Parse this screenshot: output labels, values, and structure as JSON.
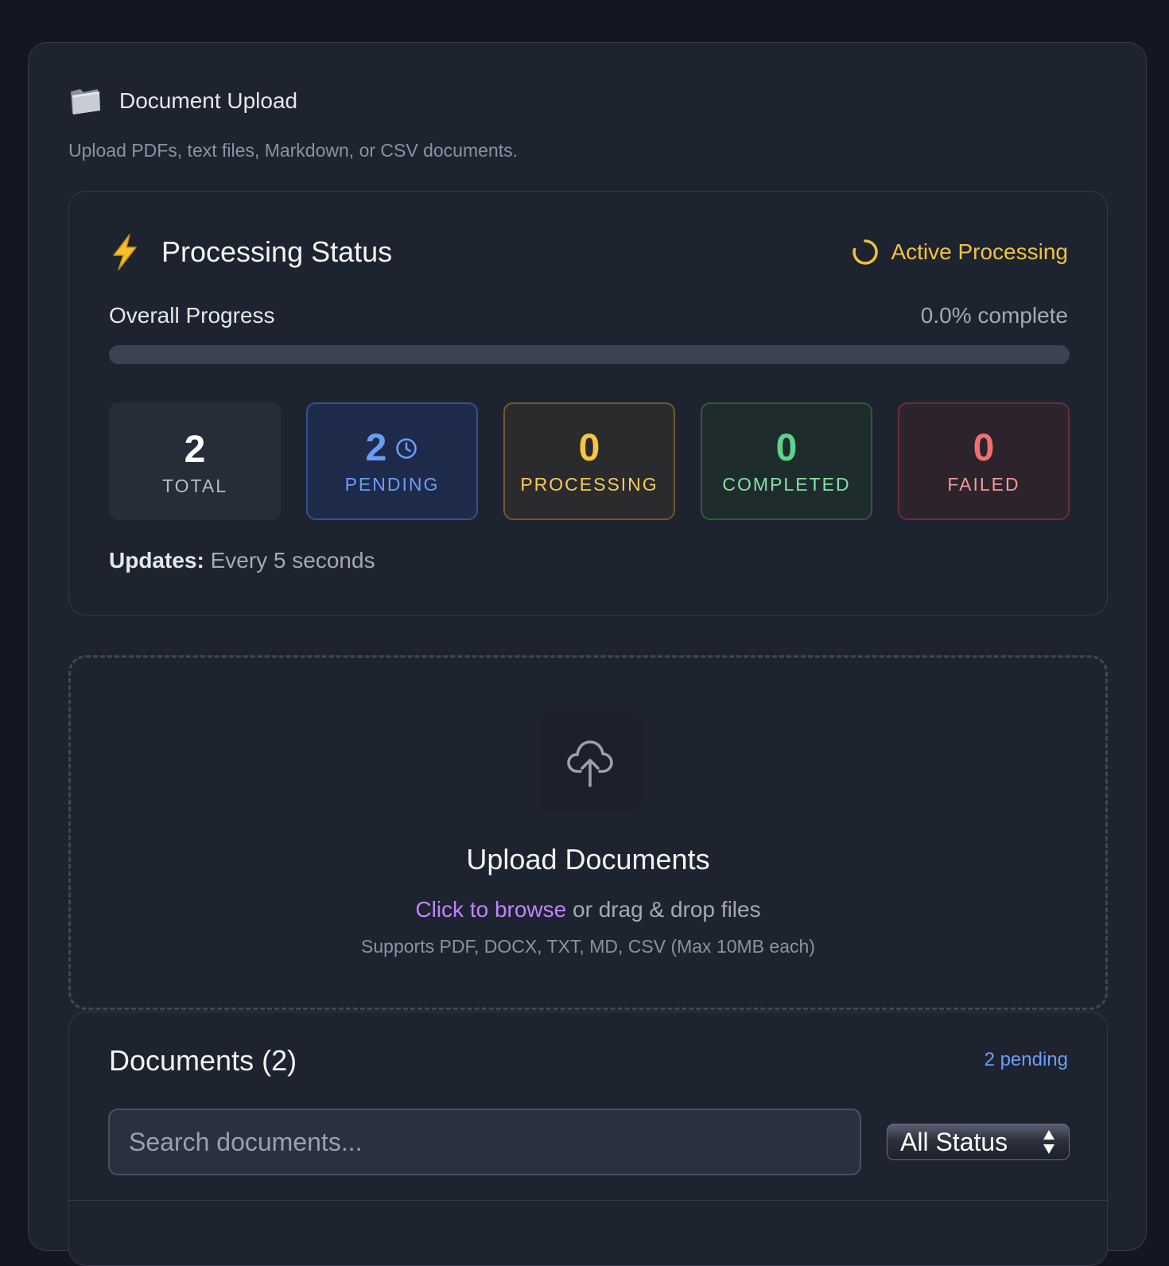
{
  "header": {
    "title": "Document Upload",
    "subtitle": "Upload PDFs, text files, Markdown, or CSV documents."
  },
  "processing": {
    "title": "Processing Status",
    "active_label": "Active Processing",
    "progress_label": "Overall Progress",
    "progress_text": "0.0% complete",
    "progress_fraction": 0.0,
    "stats": {
      "total": {
        "value": "2",
        "label": "TOTAL"
      },
      "pending": {
        "value": "2",
        "label": "PENDING"
      },
      "processing": {
        "value": "0",
        "label": "PROCESSING"
      },
      "completed": {
        "value": "0",
        "label": "COMPLETED"
      },
      "failed": {
        "value": "0",
        "label": "FAILED"
      }
    },
    "updates_label": "Updates:",
    "updates_value": "Every 5 seconds"
  },
  "upload": {
    "title": "Upload Documents",
    "browse_link": "Click to browse",
    "drag_text": "or drag & drop files",
    "supports": "Supports PDF, DOCX, TXT, MD, CSV (Max 10MB each)"
  },
  "documents": {
    "title": "Documents (2)",
    "pending_badge": "2 pending",
    "search_placeholder": "Search documents...",
    "search_value": "",
    "status_filter": "All Status"
  },
  "icons": {
    "header": "folder-icon",
    "processing": "lightning-bolt-icon",
    "active": "spinner-icon",
    "pending": "clock-icon",
    "upload": "cloud-upload-icon",
    "select": "up-down-arrows-icon"
  },
  "colors": {
    "background": "#131722",
    "panel": "#1e2330",
    "active": "#f0c33c",
    "pending": "#6b9df5",
    "processing": "#f6c63c",
    "completed": "#5fd38a",
    "failed": "#f07070",
    "link": "#c084fc"
  }
}
